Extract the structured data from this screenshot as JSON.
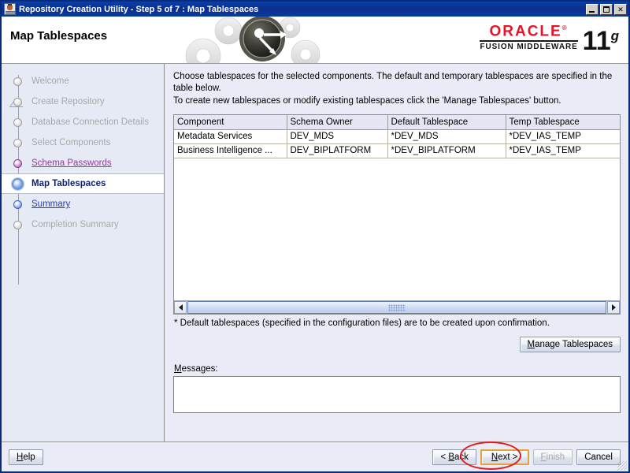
{
  "window": {
    "title": "Repository Creation Utility - Step 5 of 7 : Map Tablespaces",
    "icon": "java-app-icon",
    "minimize_label": "_",
    "maximize_label": "□",
    "close_label": "✕"
  },
  "header": {
    "page_title": "Map Tablespaces",
    "brand": "ORACLE",
    "brand_trademark": "®",
    "brand_sub": "FUSION MIDDLEWARE",
    "version": "11",
    "version_suffix": "g"
  },
  "sidebar": {
    "steps": [
      {
        "label": "Welcome",
        "state": "pending"
      },
      {
        "label": "Create Repository",
        "state": "pending"
      },
      {
        "label": "Database Connection Details",
        "state": "pending"
      },
      {
        "label": "Select Components",
        "state": "pending"
      },
      {
        "label": "Schema Passwords",
        "state": "done"
      },
      {
        "label": "Map Tablespaces",
        "state": "current"
      },
      {
        "label": "Summary",
        "state": "next"
      },
      {
        "label": "Completion Summary",
        "state": "pending"
      }
    ]
  },
  "main": {
    "intro_line1": "Choose tablespaces for the selected components. The default and temporary tablespaces are specified in the table below.",
    "intro_line2": "To create new tablespaces or modify existing tablespaces click the 'Manage Tablespaces' button.",
    "table": {
      "columns": [
        "Component",
        "Schema Owner",
        "Default Tablespace",
        "Temp Tablespace"
      ],
      "rows": [
        [
          "Metadata Services",
          "DEV_MDS",
          "*DEV_MDS",
          "*DEV_IAS_TEMP"
        ],
        [
          "Business Intelligence ...",
          "DEV_BIPLATFORM",
          "*DEV_BIPLATFORM",
          "*DEV_IAS_TEMP"
        ]
      ]
    },
    "footnote": "* Default tablespaces (specified in the configuration files) are to be created upon confirmation.",
    "manage_tablespaces_label": "Manage Tablespaces",
    "manage_tablespaces_mnemonic": "M",
    "manage_tablespaces_rest": "anage Tablespaces",
    "messages_label": "Messages:",
    "messages_mnemonic": "M",
    "messages_rest": "essages:",
    "messages_value": ""
  },
  "footer": {
    "help_mnemonic": "H",
    "help_rest": "elp",
    "back_label": "< Back",
    "back_mnemonic": "B",
    "back_pre": "< ",
    "back_rest": "ack",
    "next_label": "Next >",
    "next_mnemonic": "N",
    "next_rest": "ext >",
    "finish_label": "Finish",
    "finish_mnemonic": "F",
    "finish_rest": "inish",
    "finish_enabled": false,
    "cancel_label": "Cancel"
  },
  "annotation": {
    "highlight_target": "next-button",
    "shape": "ellipse",
    "color": "#e01b1b"
  },
  "colors": {
    "titlebar": "#0a2f8e",
    "brand_red": "#e8132b",
    "panel_bg": "#e9ecf6",
    "focus_border": "#e2a33a",
    "done_step": "#8e3f93",
    "next_step": "#2b3f9e"
  }
}
